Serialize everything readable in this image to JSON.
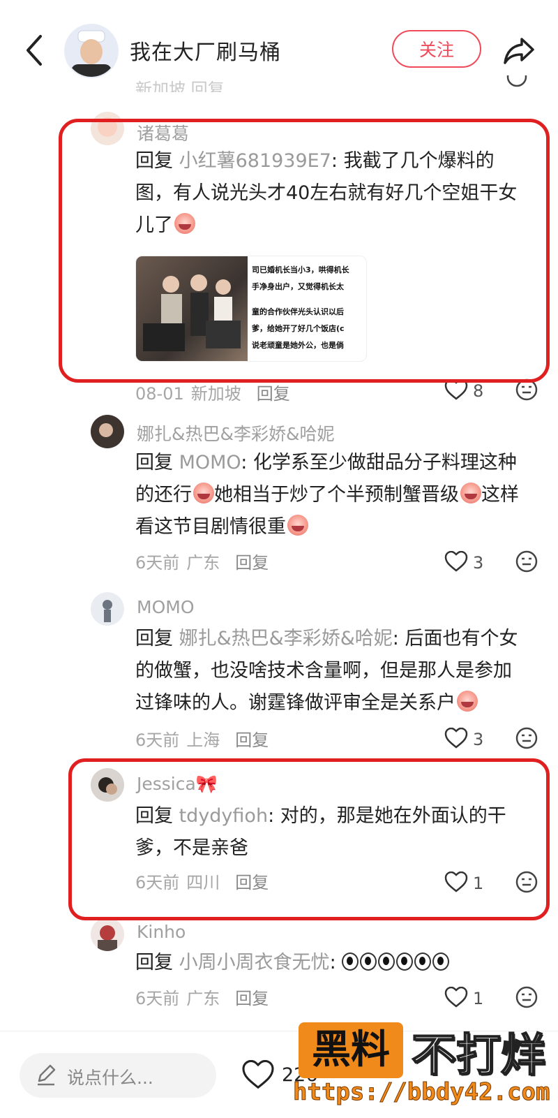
{
  "header": {
    "title": "我在大厂刷马桶",
    "follow_label": "关注",
    "icons": [
      "back-arrow-icon",
      "share-icon"
    ]
  },
  "partial_top": {
    "meta": "新加坡  回复"
  },
  "comments": [
    {
      "user": "诸葛葛",
      "reply_prefix": "回复 ",
      "reply_to": "小红薯681939E7",
      "text": ": 我截了几个爆料的图，有人说光头才40左右就有好几个空姐干女儿了",
      "has_emoji": true,
      "image_text": [
        "司已婚机长当小3，哄得机长",
        "手净身出户，又觉得机长太",
        "童的合作伙伴光头认识以后",
        "爹，给她开了好几个饭店(c",
        "说老顽童是她外公，也是倘"
      ],
      "date": "08-01",
      "location": "新加坡",
      "reply_label": "回复",
      "likes": "8"
    },
    {
      "user": "娜扎&热巴&李彩娇&哈妮",
      "reply_prefix": "回复 ",
      "reply_to": "MOMO",
      "text1": ": 化学系至少做甜品分子料理这种的还行",
      "text2": "她相当于炒了个半预制蟹晋级",
      "text3": "这样看这节目剧情很重",
      "date": "6天前",
      "location": "广东",
      "reply_label": "回复",
      "likes": "3"
    },
    {
      "user": "MOMO",
      "reply_prefix": "回复 ",
      "reply_to": "娜扎&热巴&李彩娇&哈妮",
      "text": ": 后面也有个女的做蟹，也没啥技术含量啊，但是那人是参加过锋味的人。谢霆锋做评审全是关系户",
      "date": "6天前",
      "location": "上海",
      "reply_label": "回复",
      "likes": "3"
    },
    {
      "user": "Jessica🎀",
      "reply_prefix": "回复 ",
      "reply_to": "tdydyfioh",
      "text": ": 对的，那是她在外面认的干爹，不是亲爸",
      "date": "6天前",
      "location": "四川",
      "reply_label": "回复",
      "likes": "1"
    },
    {
      "user": "Kinho",
      "reply_prefix": "回复 ",
      "reply_to": "小周小周衣食无忧",
      "text": ": ",
      "date": "6天前",
      "location": "广东",
      "reply_label": "回复",
      "likes": "1"
    }
  ],
  "bottom": {
    "input_placeholder": "说点什么...",
    "likes_total": "226"
  },
  "watermark": {
    "badge": "黑料",
    "text": "不打烊",
    "url": "https://bbdy42.com"
  },
  "colors": {
    "accent": "#ef4a5a",
    "highlight_red": "#e02020",
    "watermark_orange": "#f08a1a"
  }
}
